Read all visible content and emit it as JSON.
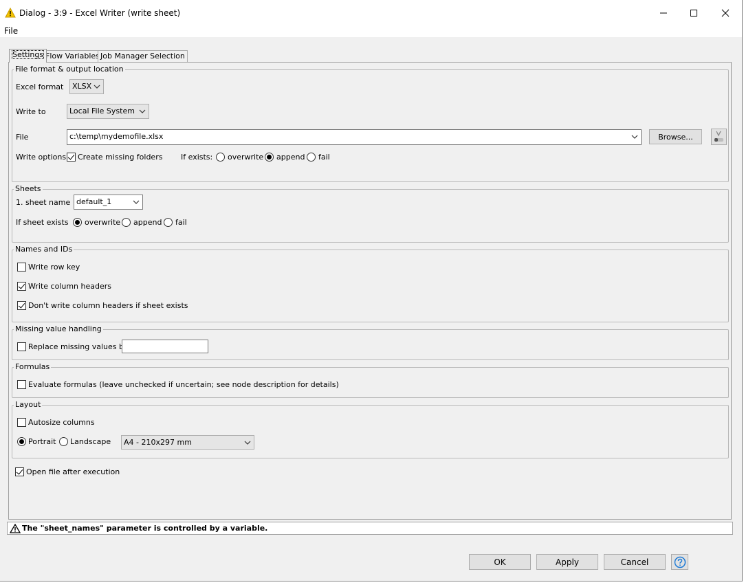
{
  "window": {
    "title": "Dialog - 3:9 - Excel Writer (write sheet)"
  },
  "menu": {
    "file": "File"
  },
  "tabs": [
    {
      "label": "Settings",
      "active": true
    },
    {
      "label": "Flow Variables",
      "active": false
    },
    {
      "label": "Job Manager Selection",
      "active": false
    }
  ],
  "file_group": {
    "legend": "File format & output location",
    "excel_format_label": "Excel format",
    "excel_format_value": "XLSX",
    "write_to_label": "Write to",
    "write_to_value": "Local File System",
    "file_label": "File",
    "file_value": "c:\\temp\\mydemofile.xlsx",
    "browse_label": "Browse...",
    "write_options_label": "Write options",
    "create_missing_folders": {
      "label": "Create missing folders",
      "checked": true
    },
    "if_exists_label": "If exists:",
    "if_exists_options": [
      {
        "label": "overwrite",
        "selected": false
      },
      {
        "label": "append",
        "selected": true
      },
      {
        "label": "fail",
        "selected": false
      }
    ]
  },
  "sheets_group": {
    "legend": "Sheets",
    "sheet_name_label": "1. sheet name",
    "sheet_name_value": "default_1",
    "if_sheet_exists_label": "If sheet exists",
    "if_sheet_exists_options": [
      {
        "label": "overwrite",
        "selected": true
      },
      {
        "label": "append",
        "selected": false
      },
      {
        "label": "fail",
        "selected": false
      }
    ]
  },
  "names_group": {
    "legend": "Names and IDs",
    "write_row_key": {
      "label": "Write row key",
      "checked": false
    },
    "write_column_headers": {
      "label": "Write column headers",
      "checked": true
    },
    "dont_write_headers": {
      "label": "Don't write column headers if sheet exists",
      "checked": true
    }
  },
  "missing_group": {
    "legend": "Missing value handling",
    "replace_missing": {
      "label": "Replace missing values by",
      "checked": false
    },
    "replace_value": ""
  },
  "formulas_group": {
    "legend": "Formulas",
    "evaluate": {
      "label": "Evaluate formulas (leave unchecked if uncertain; see node description for details)",
      "checked": false
    }
  },
  "layout_group": {
    "legend": "Layout",
    "autosize": {
      "label": "Autosize columns",
      "checked": false
    },
    "portrait": {
      "label": "Portrait",
      "selected": true
    },
    "landscape": {
      "label": "Landscape",
      "selected": false
    },
    "paper_size": "A4 - 210x297 mm"
  },
  "open_after": {
    "label": "Open file after execution",
    "checked": true
  },
  "status": {
    "message": "The \"sheet_names\" parameter is controlled by a variable."
  },
  "buttons": {
    "ok": "OK",
    "apply": "Apply",
    "cancel": "Cancel"
  },
  "colors": {
    "warning": "#f5c400",
    "help": "#1e7bd6"
  },
  "icons": {
    "title": "warning-triangle-icon",
    "status": "warning-triangle-icon",
    "help": "help-question-icon",
    "variable": "flow-variable-icon"
  }
}
